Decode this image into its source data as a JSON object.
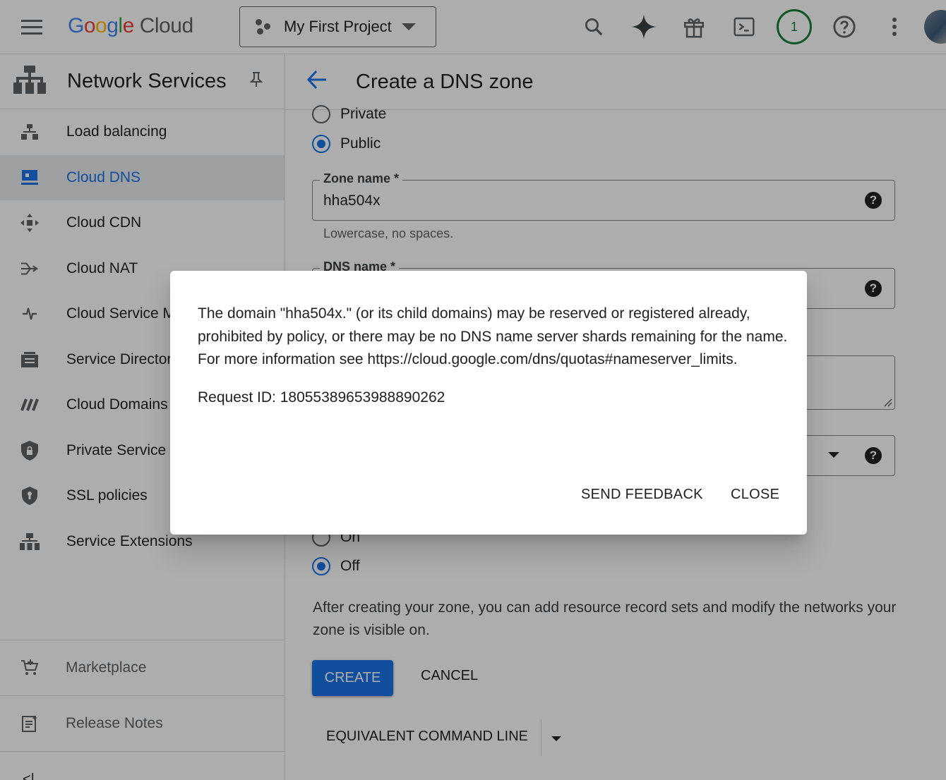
{
  "topbar": {
    "logo_google": "Google",
    "logo_cloud": "Cloud",
    "project_name": "My First Project",
    "notification_count": "1"
  },
  "sidebar": {
    "title": "Network Services",
    "items": [
      {
        "label": "Load balancing",
        "icon": "load-balancing-icon"
      },
      {
        "label": "Cloud DNS",
        "icon": "cloud-dns-icon",
        "active": true
      },
      {
        "label": "Cloud CDN",
        "icon": "cloud-cdn-icon"
      },
      {
        "label": "Cloud NAT",
        "icon": "cloud-nat-icon"
      },
      {
        "label": "Cloud Service M",
        "icon": "cloud-service-mesh-icon"
      },
      {
        "label": "Service Director",
        "icon": "service-directory-icon"
      },
      {
        "label": "Cloud Domains",
        "icon": "cloud-domains-icon"
      },
      {
        "label": "Private Service (",
        "icon": "private-service-connect-icon"
      },
      {
        "label": "SSL policies",
        "icon": "ssl-policies-icon"
      },
      {
        "label": "Service Extensions",
        "icon": "service-extensions-icon"
      }
    ],
    "footer": [
      {
        "label": "Marketplace",
        "icon": "marketplace-icon"
      },
      {
        "label": "Release Notes",
        "icon": "release-notes-icon"
      }
    ]
  },
  "main": {
    "title": "Create a DNS zone",
    "type_options": [
      {
        "label": "Private",
        "selected": false
      },
      {
        "label": "Public",
        "selected": true
      }
    ],
    "zone_name": {
      "label": "Zone name *",
      "value": "hha504x",
      "hint": "Lowercase, no spaces."
    },
    "dns_name": {
      "label": "DNS name *"
    },
    "dnssec_options": [
      {
        "label": "On",
        "selected": false
      },
      {
        "label": "Off",
        "selected": true
      }
    ],
    "info_text": "After creating your zone, you can add resource record sets and modify the networks your zone is visible on.",
    "create_label": "CREATE",
    "cancel_label": "CANCEL",
    "equivalent_label": "EQUIVALENT COMMAND LINE"
  },
  "dialog": {
    "message": "The domain \"hha504x.\" (or its child domains) may be reserved or registered already, prohibited by policy, or there may be no DNS name server shards remaining for the name. For more information see https://cloud.google.com/dns/quotas#nameserver_limits.",
    "request_id": "Request ID: 18055389653988890262",
    "send_feedback_label": "SEND FEEDBACK",
    "close_label": "CLOSE"
  },
  "colors": {
    "primary": "#1a73e8",
    "notification_ring": "#188038",
    "scrim": "rgba(0,0,0,0.32)"
  }
}
